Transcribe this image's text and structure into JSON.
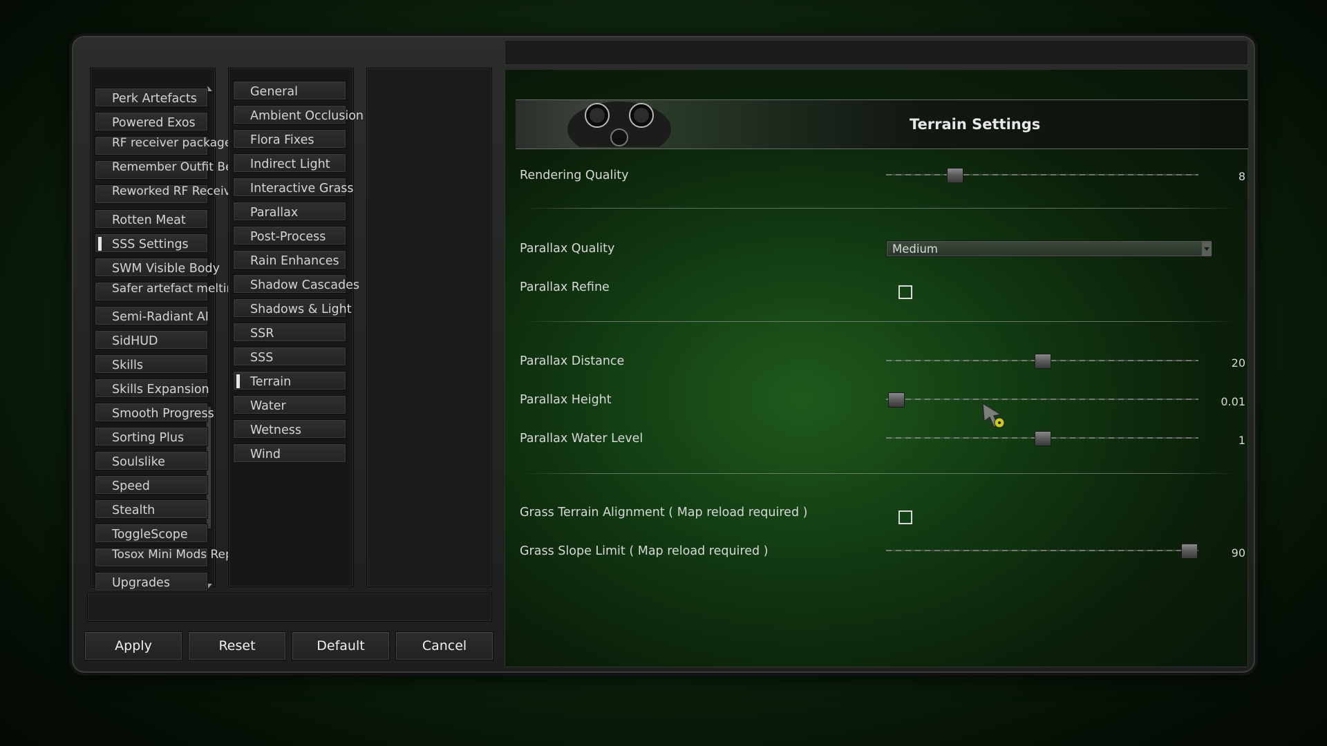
{
  "column1": {
    "items": [
      {
        "label": "Perk Artefacts"
      },
      {
        "label": "Powered Exos"
      },
      {
        "label": "RF receiver package options"
      },
      {
        "label": "Remember Outfit Belt"
      },
      {
        "label": "Reworked RF Receiver"
      },
      {
        "label": "Rotten Meat"
      },
      {
        "label": "SSS Settings",
        "selected": true
      },
      {
        "label": "SWM Visible Body"
      },
      {
        "label": "Safer artefact melting"
      },
      {
        "label": "Semi-Radiant AI"
      },
      {
        "label": "SidHUD"
      },
      {
        "label": "Skills"
      },
      {
        "label": "Skills Expansion"
      },
      {
        "label": "Smooth Progress"
      },
      {
        "label": "Sorting Plus"
      },
      {
        "label": "Soulslike"
      },
      {
        "label": "Speed"
      },
      {
        "label": "Stealth"
      },
      {
        "label": "ToggleScope"
      },
      {
        "label": "Tosox Mini Mods Repo"
      },
      {
        "label": "Upgrades"
      }
    ]
  },
  "column2": {
    "items": [
      {
        "label": "General"
      },
      {
        "label": "Ambient Occlusion"
      },
      {
        "label": "Flora Fixes"
      },
      {
        "label": "Indirect Light"
      },
      {
        "label": "Interactive Grass"
      },
      {
        "label": "Parallax"
      },
      {
        "label": "Post-Process"
      },
      {
        "label": "Rain Enhances"
      },
      {
        "label": "Shadow Cascades"
      },
      {
        "label": "Shadows & Light"
      },
      {
        "label": "SSR"
      },
      {
        "label": "SSS"
      },
      {
        "label": "Terrain",
        "selected": true
      },
      {
        "label": "Water"
      },
      {
        "label": "Wetness"
      },
      {
        "label": "Wind"
      }
    ]
  },
  "buttons": {
    "apply": "Apply",
    "reset": "Reset",
    "default": "Default",
    "cancel": "Cancel"
  },
  "settings": {
    "title": "Terrain Settings",
    "rendering_quality": {
      "label": "Rendering Quality",
      "value": "8",
      "fraction": 0.22
    },
    "parallax_quality": {
      "label": "Parallax Quality",
      "value": "Medium"
    },
    "parallax_refine": {
      "label": "Parallax Refine",
      "checked": false
    },
    "parallax_distance": {
      "label": "Parallax Distance",
      "value": "20",
      "fraction": 0.5
    },
    "parallax_height": {
      "label": "Parallax Height",
      "value": "0.01",
      "fraction": 0.03
    },
    "parallax_water_level": {
      "label": "Parallax Water Level",
      "value": "1",
      "fraction": 0.5
    },
    "grass_terrain_alignment": {
      "label": "Grass Terrain Alignment ( Map reload required )",
      "checked": false
    },
    "grass_slope_limit": {
      "label": "Grass Slope Limit ( Map reload required )",
      "value": "90",
      "fraction": 0.97
    }
  },
  "colors": {
    "accent_green": "#1f5a1c",
    "text": "#d8d8d8",
    "selection_bar": "#e6e6e6"
  }
}
